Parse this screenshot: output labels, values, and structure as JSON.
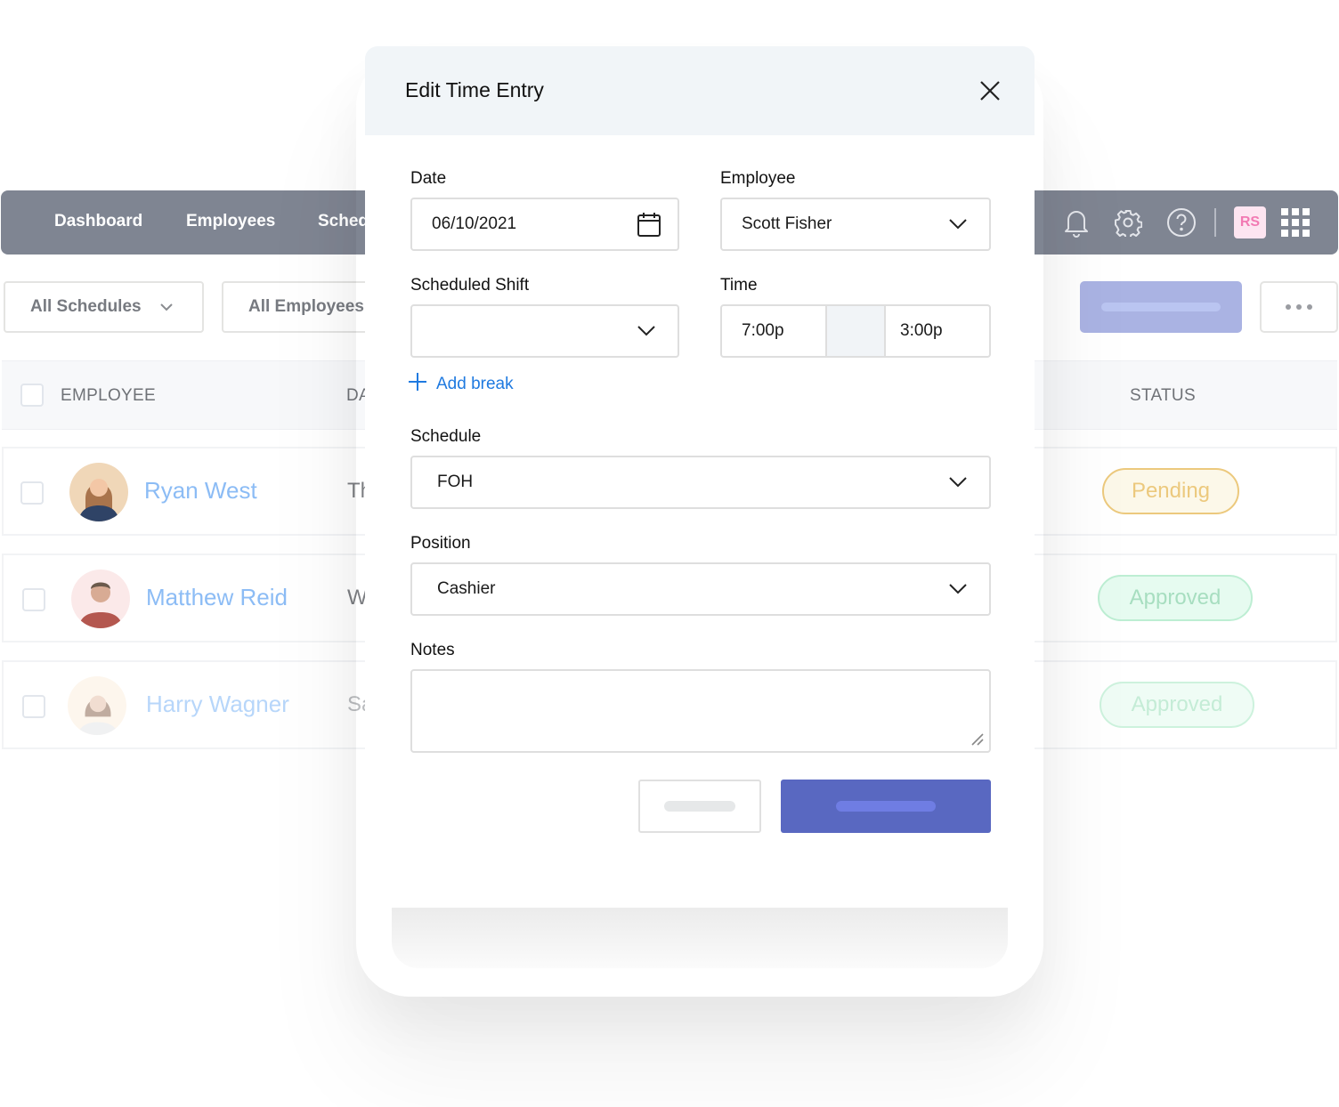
{
  "nav": {
    "links": [
      "Dashboard",
      "Employees",
      "Schedules"
    ],
    "icons": [
      "bell-icon",
      "gear-icon",
      "help-icon",
      "apps-grid-icon"
    ],
    "user_initials": "RS",
    "user_avatar_bg": "#fde5f1",
    "user_avatar_fg": "#f27ab3",
    "bar_color": "#7f8592"
  },
  "filters": {
    "schedules": "All Schedules",
    "employees": "All Employees"
  },
  "table": {
    "columns": [
      "EMPLOYEE",
      "DATE",
      "STATUS"
    ],
    "rows": [
      {
        "name": "Ryan West",
        "day": "Th",
        "status": "Pending"
      },
      {
        "name": "Matthew Reid",
        "day": "W",
        "status": "Approved"
      },
      {
        "name": "Harry Wagner",
        "day": "Sa",
        "status": "Approved"
      }
    ]
  },
  "modal": {
    "title": "Edit Time Entry",
    "fields": {
      "date": {
        "label": "Date",
        "value": "06/10/2021"
      },
      "employee": {
        "label": "Employee",
        "value": "Scott Fisher"
      },
      "scheduled_shift": {
        "label": "Scheduled Shift",
        "value": ""
      },
      "time": {
        "label": "Time",
        "start": "7:00p",
        "end": "3:00p"
      },
      "schedule": {
        "label": "Schedule",
        "value": "FOH"
      },
      "position": {
        "label": "Position",
        "value": "Cashier"
      },
      "notes": {
        "label": "Notes",
        "value": ""
      }
    },
    "add_break_label": "Add break",
    "accent_color": "#1f7ae0",
    "primary_color": "#5968c1"
  }
}
